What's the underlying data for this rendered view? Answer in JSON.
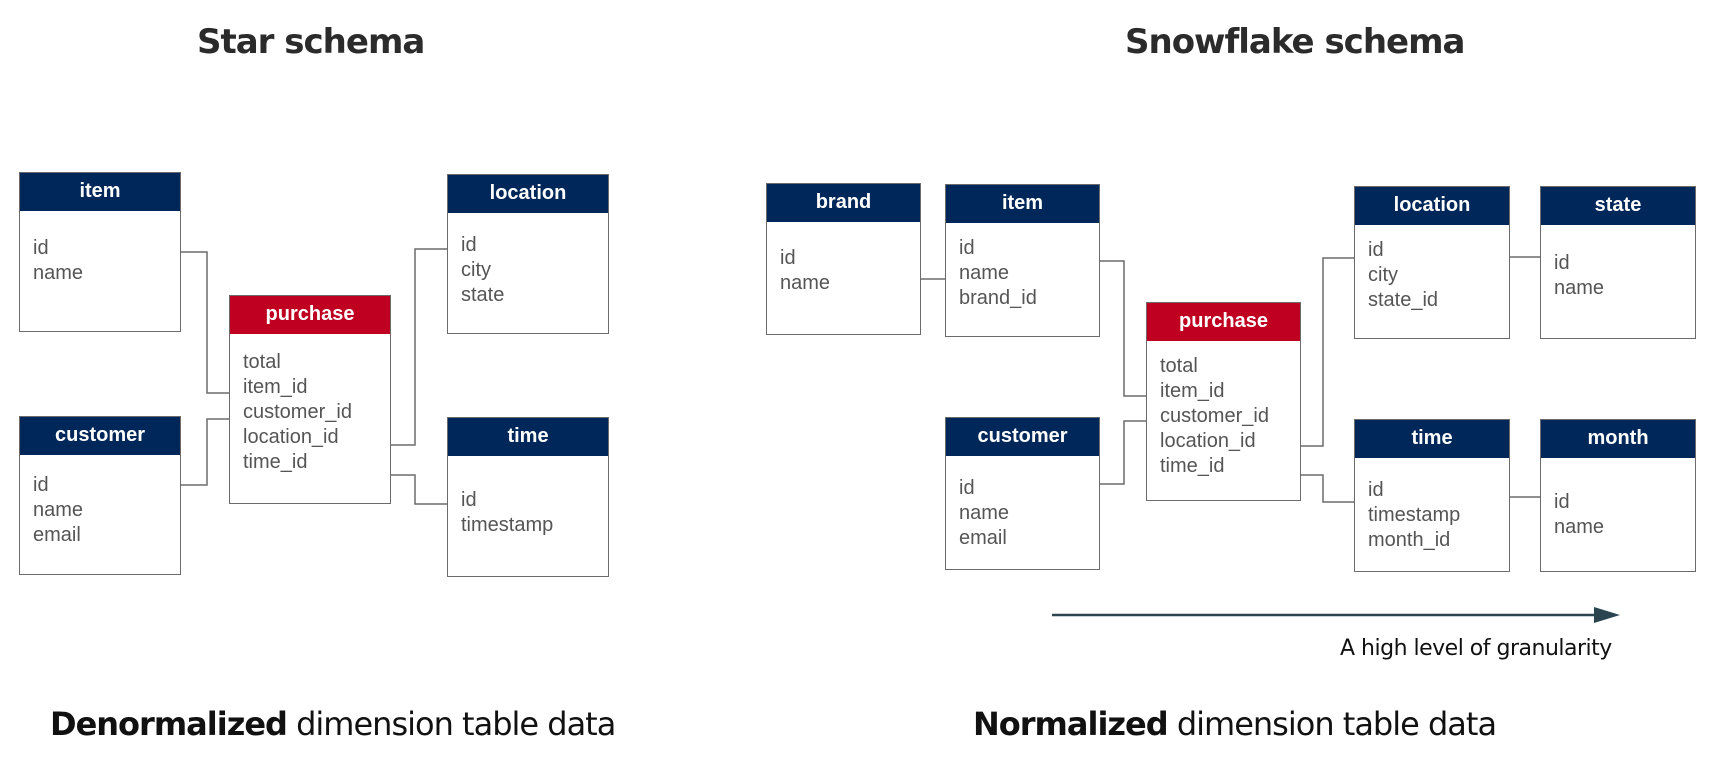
{
  "star": {
    "title": "Star schema",
    "caption_bold": "Denormalized",
    "caption_rest": " dimension table data",
    "tables": {
      "item": {
        "name": "item",
        "fields": [
          "id",
          "name"
        ]
      },
      "customer": {
        "name": "customer",
        "fields": [
          "id",
          "name",
          "email"
        ]
      },
      "purchase": {
        "name": "purchase",
        "fields": [
          "total",
          "item_id",
          "customer_id",
          "location_id",
          "time_id"
        ]
      },
      "location": {
        "name": "location",
        "fields": [
          "id",
          "city",
          "state"
        ]
      },
      "time": {
        "name": "time",
        "fields": [
          "id",
          "timestamp"
        ]
      }
    }
  },
  "snowflake": {
    "title": "Snowflake schema",
    "caption_bold": "Normalized",
    "caption_rest": " dimension table data",
    "arrow_label": "A high level of granularity",
    "tables": {
      "brand": {
        "name": "brand",
        "fields": [
          "id",
          "name"
        ]
      },
      "item": {
        "name": "item",
        "fields": [
          "id",
          "name",
          "brand_id"
        ]
      },
      "customer": {
        "name": "customer",
        "fields": [
          "id",
          "name",
          "email"
        ]
      },
      "purchase": {
        "name": "purchase",
        "fields": [
          "total",
          "item_id",
          "customer_id",
          "location_id",
          "time_id"
        ]
      },
      "location": {
        "name": "location",
        "fields": [
          "id",
          "city",
          "state_id"
        ]
      },
      "state": {
        "name": "state",
        "fields": [
          "id",
          "name"
        ]
      },
      "time": {
        "name": "time",
        "fields": [
          "id",
          "timestamp",
          "month_id"
        ]
      },
      "month": {
        "name": "month",
        "fields": [
          "id",
          "name"
        ]
      }
    }
  },
  "colors": {
    "dimension_header": "#00275a",
    "fact_header": "#c00020",
    "arrow": "#2a4550"
  }
}
